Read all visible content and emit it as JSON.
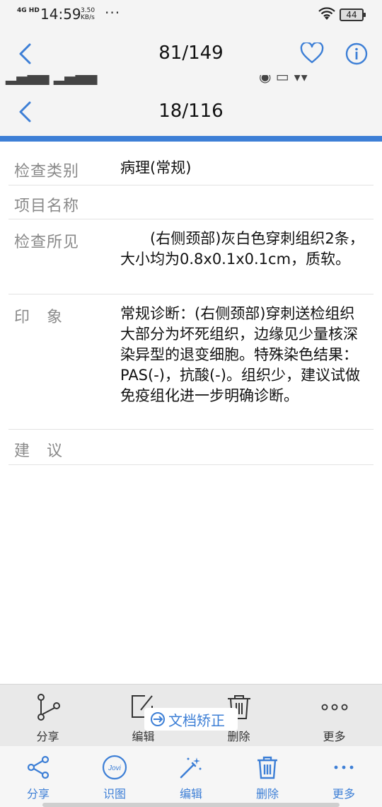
{
  "status_bar": {
    "network": "4G HD",
    "time": "14:59",
    "speed": "3.50",
    "speed_unit": "KB/s",
    "dots": "···",
    "battery": "44"
  },
  "outer_header": {
    "counter": "81/149"
  },
  "inner_header": {
    "counter": "18/116"
  },
  "report": {
    "rows": [
      {
        "label": "检查类别",
        "value": "病理(常规)"
      },
      {
        "label": "项目名称",
        "value": ""
      },
      {
        "label": "检查所见",
        "value": "　　(右侧颈部)灰白色穿刺组织2条，大小均为0.8x0.1x0.1cm，质软。"
      },
      {
        "label": "印　象",
        "value": "常规诊断：(右侧颈部)穿刺送检组织大部分为坏死组织，边缘见少量核深染异型的退变细胞。特殊染色结果：PAS(-)，抗酸(-)。组织少，建议试做免疫组化进一步明确诊断。"
      },
      {
        "label": "建　议",
        "value": ""
      }
    ]
  },
  "screenshot_toolbar": {
    "share": "分享",
    "edit": "编辑",
    "delete": "删除",
    "more": "更多",
    "doc_correct": "文档矫正"
  },
  "app_toolbar": {
    "share": "分享",
    "recognize": "识图",
    "edit": "编辑",
    "delete": "删除",
    "more": "更多"
  },
  "colors": {
    "accent": "#3d7fd6",
    "label_gray": "#8a8a8a"
  }
}
